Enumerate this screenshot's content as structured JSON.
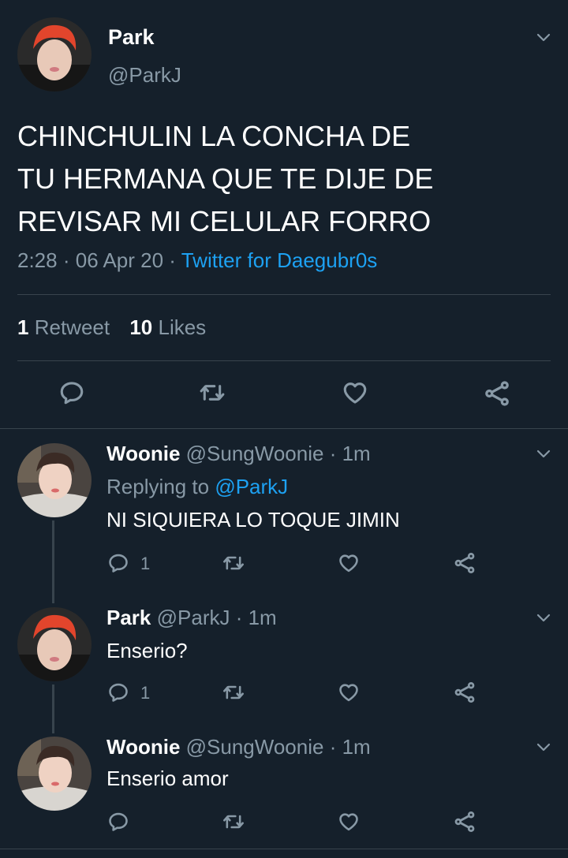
{
  "main_tweet": {
    "name": "Park",
    "handle": "@ParkJ",
    "text_lines": [
      "CHINCHULIN LA CONCHA DE",
      "TU HERMANA QUE TE DIJE DE",
      "REVISAR MI CELULAR FORRO"
    ],
    "time": "2:28",
    "date": "06 Apr 20",
    "separator": "·",
    "source": "Twitter for Daegubr0s",
    "retweets_count": "1",
    "retweets_label": "Retweet",
    "likes_count": "10",
    "likes_label": "Likes"
  },
  "replies": [
    {
      "name": "Woonie",
      "handle": "@SungWoonie",
      "time": "· 1m",
      "replying_label": "Replying to",
      "replying_handle": "@ParkJ",
      "text": "NI SIQUIERA LO TOQUE JIMIN",
      "reply_count": "1"
    },
    {
      "name": "Park",
      "handle": "@ParkJ",
      "time": "· 1m",
      "text": "Enserio?",
      "reply_count": "1"
    },
    {
      "name": "Woonie",
      "handle": "@SungWoonie",
      "time": "· 1m",
      "text": "Enserio amor",
      "reply_count": ""
    }
  ],
  "icons": [
    "chevron-down-icon",
    "reply-icon",
    "retweet-icon",
    "like-icon",
    "share-icon"
  ],
  "colors": {
    "background": "#15202b",
    "muted": "#8899a6",
    "accent": "#1da1f2",
    "divider": "#38444d"
  }
}
